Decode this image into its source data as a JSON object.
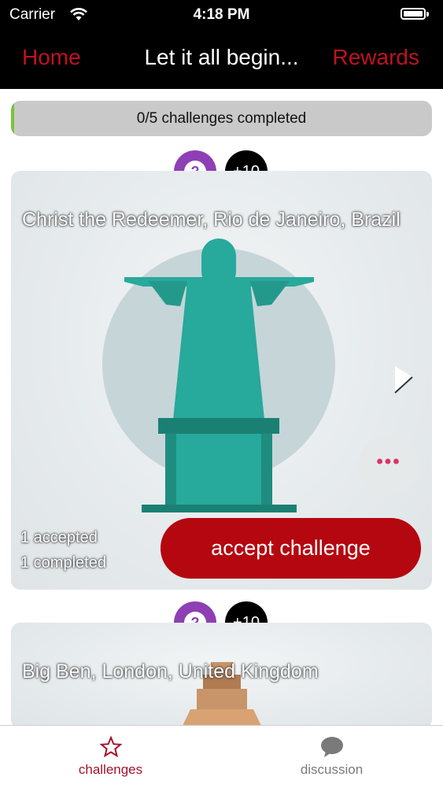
{
  "status_bar": {
    "carrier": "Carrier",
    "time": "4:18 PM"
  },
  "nav": {
    "left": "Home",
    "title": "Let it all begin...",
    "right": "Rewards"
  },
  "progress": {
    "label": "0/5 challenges completed",
    "completed": 0,
    "total": 5
  },
  "challenges": [
    {
      "points": "+10",
      "question_mark": "?",
      "title": "Christ the Redeemer, Rio de Janeiro, Brazil",
      "accepted": "1 accepted",
      "completed": "1 completed",
      "accept_label": "accept challenge",
      "more_dots": "•••"
    },
    {
      "points": "+10",
      "question_mark": "?",
      "title": "Big Ben, London, United Kingdom"
    }
  ],
  "tabbar": {
    "challenges": "challenges",
    "discussion": "discussion"
  },
  "colors": {
    "accent": "#c1121f",
    "button": "#b5070f",
    "badge": "#8e3fb4",
    "statue": "#27a99b"
  }
}
